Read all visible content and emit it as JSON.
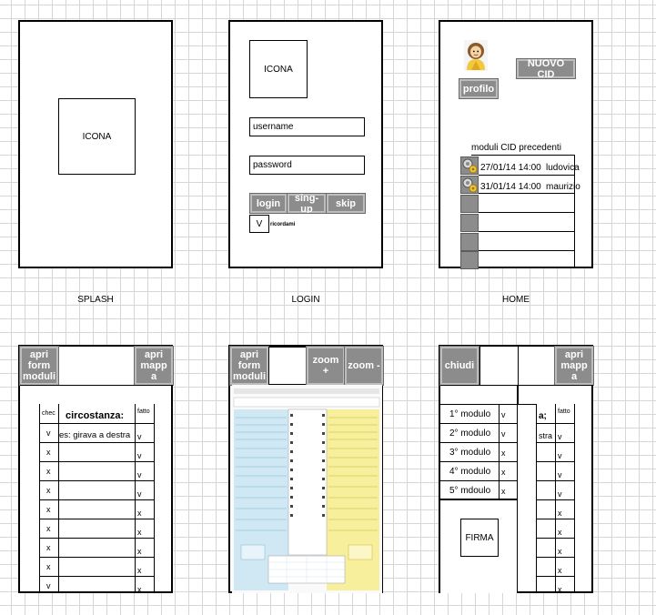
{
  "splash": {
    "icon": "ICONA",
    "label": "SPLASH"
  },
  "login": {
    "icon": "ICONA",
    "username_placeholder": "username",
    "password_placeholder": "password",
    "login_btn": "login",
    "signup_btn": "sing-up",
    "skip_btn": "skip",
    "remember_check": "V",
    "remember_label": "ricordami",
    "label": "LOGIN"
  },
  "home": {
    "profile_btn": "profilo",
    "new_cid_btn": "NUOVO CID",
    "list_title": "moduli CID precedenti",
    "entries": [
      {
        "date": "27/01/14 14:00",
        "name": "ludovica"
      },
      {
        "date": "31/01/14 14:00",
        "name": "maurizio"
      }
    ],
    "label": "HOME"
  },
  "form": {
    "open_forms_btn": "apri form moduli",
    "open_map_btn": "apri mapp a",
    "col_check": "chec",
    "col_circ": "circostanza:",
    "col_done": "fatto",
    "example_text": "es: girava a destra",
    "checks": [
      "v",
      "x",
      "x",
      "x",
      "x",
      "x",
      "x",
      "x",
      "v"
    ],
    "done": [
      "v",
      "v",
      "v",
      "v",
      "x",
      "x",
      "x",
      "x",
      "x"
    ]
  },
  "document": {
    "open_forms_btn": "apri form moduli",
    "zoom_in_btn": "zoom +",
    "zoom_out_btn": "zoom -"
  },
  "modules": {
    "close_btn": "chiudi",
    "open_map_btn": "apri mapp a",
    "items": [
      {
        "label": "1° modulo",
        "mark": "v"
      },
      {
        "label": "2° modulo",
        "mark": "v"
      },
      {
        "label": "3° modulo",
        "mark": "x"
      },
      {
        "label": "4° modulo",
        "mark": "x"
      },
      {
        "label": "5° mdoulo",
        "mark": "x"
      }
    ],
    "right_header": "a;",
    "right_col": "fatto",
    "right_partial": "stra",
    "right_done": [
      "v",
      "v",
      "v",
      "v",
      "x",
      "x",
      "x",
      "x",
      "x"
    ],
    "sign_btn": "FIRMA"
  }
}
